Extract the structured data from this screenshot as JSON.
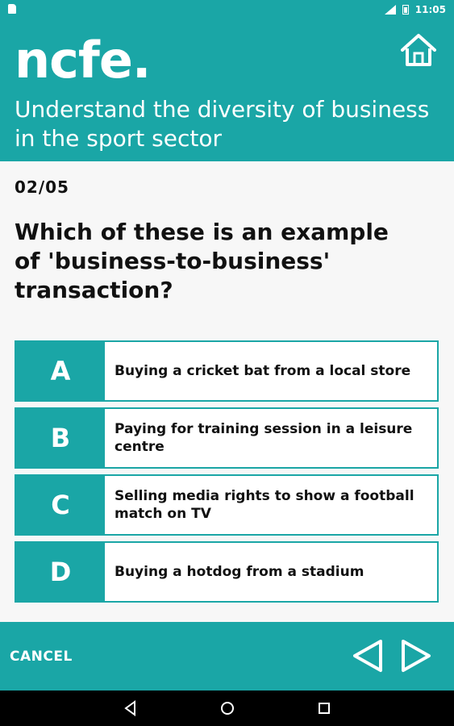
{
  "status_bar": {
    "time": "11:05"
  },
  "header": {
    "logo": "ncfe.",
    "course_title": "Understand the diversity of business in the sport sector"
  },
  "question": {
    "counter": "02/05",
    "text": "Which of these is an example of 'business-to-business' transaction?"
  },
  "answers": [
    {
      "letter": "A",
      "text": "Buying a cricket bat from a local store"
    },
    {
      "letter": "B",
      "text": "Paying for training session in a leisure centre"
    },
    {
      "letter": "C",
      "text": "Selling media rights to show a football match on TV"
    },
    {
      "letter": "D",
      "text": "Buying a hotdog from a stadium"
    }
  ],
  "footer": {
    "cancel_label": "CANCEL"
  },
  "icons": {
    "home": "home-icon",
    "prev": "triangle-left-icon",
    "next": "triangle-right-icon",
    "android_back": "back-icon",
    "android_home": "circle-home-icon",
    "android_recents": "square-recents-icon"
  },
  "colors": {
    "accent": "#1aa6a6",
    "background": "#f7f7f7",
    "text": "#111111"
  }
}
